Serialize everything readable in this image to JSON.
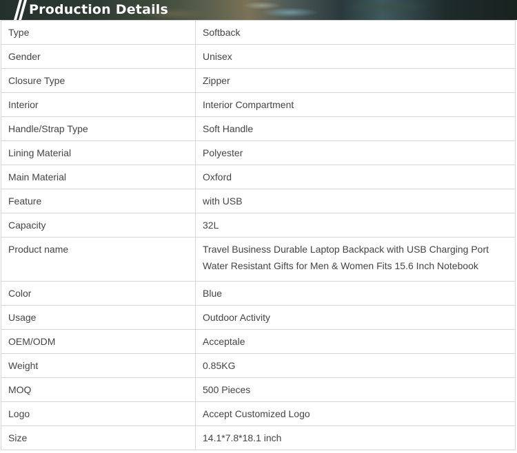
{
  "header": {
    "title": "Production Details"
  },
  "specs": [
    {
      "label": "Type",
      "value": "Softback"
    },
    {
      "label": "Gender",
      "value": "Unisex"
    },
    {
      "label": "Closure Type",
      "value": "Zipper"
    },
    {
      "label": "Interior",
      "value": "Interior Compartment"
    },
    {
      "label": "Handle/Strap Type",
      "value": "Soft Handle"
    },
    {
      "label": "Lining Material",
      "value": "Polyester"
    },
    {
      "label": "Main Material",
      "value": "Oxford"
    },
    {
      "label": "Feature",
      "value": "with USB"
    },
    {
      "label": "Capacity",
      "value": "32L"
    },
    {
      "label": "Product name",
      "value": "Travel Business Durable Laptop Backpack with USB Charging Port Water Resistant Gifts for Men & Women Fits 15.6 Inch Notebook"
    },
    {
      "label": "Color",
      "value": "Blue"
    },
    {
      "label": "Usage",
      "value": "Outdoor Activity"
    },
    {
      "label": "OEM/ODM",
      "value": "Acceptale"
    },
    {
      "label": "Weight",
      "value": "0.85KG"
    },
    {
      "label": "MOQ",
      "value": "500 Pieces"
    },
    {
      "label": "Logo",
      "value": "Accept Customized Logo"
    },
    {
      "label": "Size",
      "value": "14.1*7.8*18.1 inch"
    }
  ]
}
